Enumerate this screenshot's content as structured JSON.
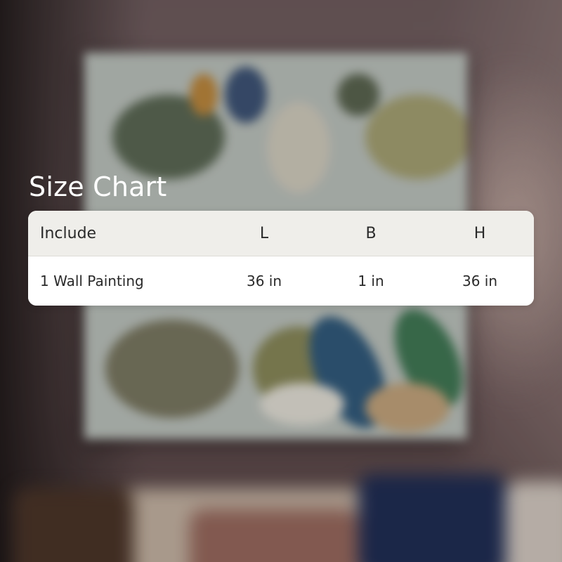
{
  "title": "Size Chart",
  "table": {
    "headers": [
      "Include",
      "L",
      "B",
      "H"
    ],
    "rows": [
      [
        "1 Wall Painting",
        "36 in",
        "1 in",
        "36 in"
      ]
    ]
  },
  "colors": {
    "title_text": "#ffffff",
    "header_bg": "#efeeea",
    "body_bg": "#ffffff",
    "cell_text": "#2a2a2a"
  }
}
